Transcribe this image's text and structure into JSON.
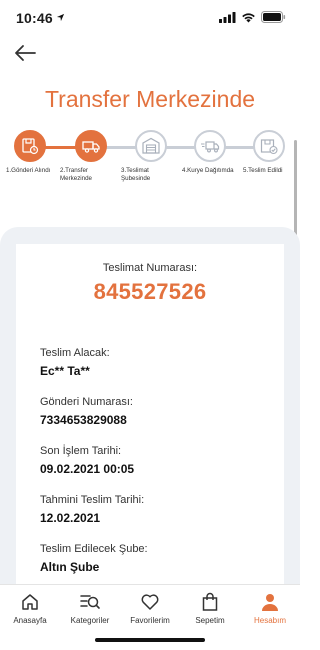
{
  "status_bar": {
    "time": "10:46"
  },
  "header": {
    "title": "Transfer Merkezinde"
  },
  "steps": [
    {
      "label": "1.Gönderi Alındı",
      "icon": "package-timer-icon",
      "active": true
    },
    {
      "label": "2.Transfer Merkezinde",
      "icon": "truck-icon",
      "active": true
    },
    {
      "label": "3.Teslimat Şubesinde",
      "icon": "warehouse-icon",
      "active": false
    },
    {
      "label": "4.Kurye Dağıtımda",
      "icon": "fast-delivery-icon",
      "active": false
    },
    {
      "label": "5.Teslim Edildi",
      "icon": "box-check-icon",
      "active": false
    }
  ],
  "tracking": {
    "label": "Teslimat Numarası:",
    "number": "845527526"
  },
  "details": [
    {
      "label": "Teslim Alacak:",
      "value": "Ec** Ta**"
    },
    {
      "label": "Gönderi Numarası:",
      "value": "7334653829088"
    },
    {
      "label": "Son İşlem Tarihi:",
      "value": "09.02.2021 00:05"
    },
    {
      "label": "Tahmini Teslim Tarihi:",
      "value": "12.02.2021"
    },
    {
      "label": "Teslim Edilecek Şube:",
      "value": "Altın Şube"
    }
  ],
  "tabs": [
    {
      "label": "Anasayfa",
      "icon": "home-icon",
      "active": false
    },
    {
      "label": "Kategoriler",
      "icon": "categories-search-icon",
      "active": false
    },
    {
      "label": "Favorilerim",
      "icon": "heart-icon",
      "active": false
    },
    {
      "label": "Sepetim",
      "icon": "shopping-bag-icon",
      "active": false
    },
    {
      "label": "Hesabım",
      "icon": "user-icon",
      "active": true
    }
  ],
  "colors": {
    "accent": "#e3723e",
    "inactive_step": "#c9ced6",
    "panel_bg": "#eef1f5"
  }
}
